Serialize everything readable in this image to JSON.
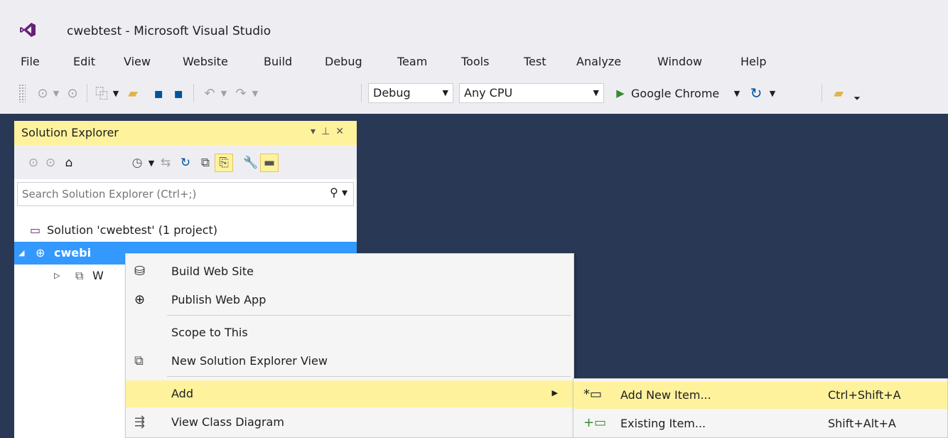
{
  "window": {
    "title": "cwebtest - Microsoft Visual Studio",
    "logo_icon": "visual-studio-logo-icon",
    "accent": "#68217a"
  },
  "menu": [
    "File",
    "Edit",
    "View",
    "Website",
    "Build",
    "Debug",
    "Team",
    "Tools",
    "Test",
    "Analyze",
    "Window",
    "Help"
  ],
  "toolbar": {
    "config_value": "Debug",
    "platform_value": "Any CPU",
    "run_label": "Google Chrome"
  },
  "solution_explorer": {
    "title": "Solution Explorer",
    "search_placeholder": "Search Solution Explorer (Ctrl+;)",
    "tree": [
      {
        "label": "Solution 'cwebtest' (1 project)",
        "icon": "solution-icon"
      },
      {
        "label": "cwebi",
        "icon": "website-globe-icon",
        "selected": true
      },
      {
        "label": "W",
        "icon": "web-references-icon"
      }
    ],
    "header_bg": "#fff29d",
    "selection_color": "#3399ff"
  },
  "context_menu": {
    "items": [
      {
        "label": "Build Web Site",
        "icon": "build-icon"
      },
      {
        "label": "Publish Web App",
        "icon": "publish-globe-icon"
      },
      {
        "label": "Scope to This",
        "icon": ""
      },
      {
        "label": "New Solution Explorer View",
        "icon": "new-view-icon"
      },
      {
        "label": "Add",
        "icon": "",
        "has_submenu": true,
        "highlighted": true
      },
      {
        "label": "View Class Diagram",
        "icon": "class-diagram-icon"
      }
    ]
  },
  "submenu": {
    "items": [
      {
        "label": "Add New Item...",
        "shortcut": "Ctrl+Shift+A",
        "icon": "add-new-item-icon",
        "highlighted": true
      },
      {
        "label": "Existing Item...",
        "shortcut": "Shift+Alt+A",
        "icon": "existing-item-icon"
      }
    ]
  },
  "colors": {
    "editor_bg": "#293955",
    "highlight": "#fff29d",
    "chrome_bg": "#eeeef2"
  }
}
